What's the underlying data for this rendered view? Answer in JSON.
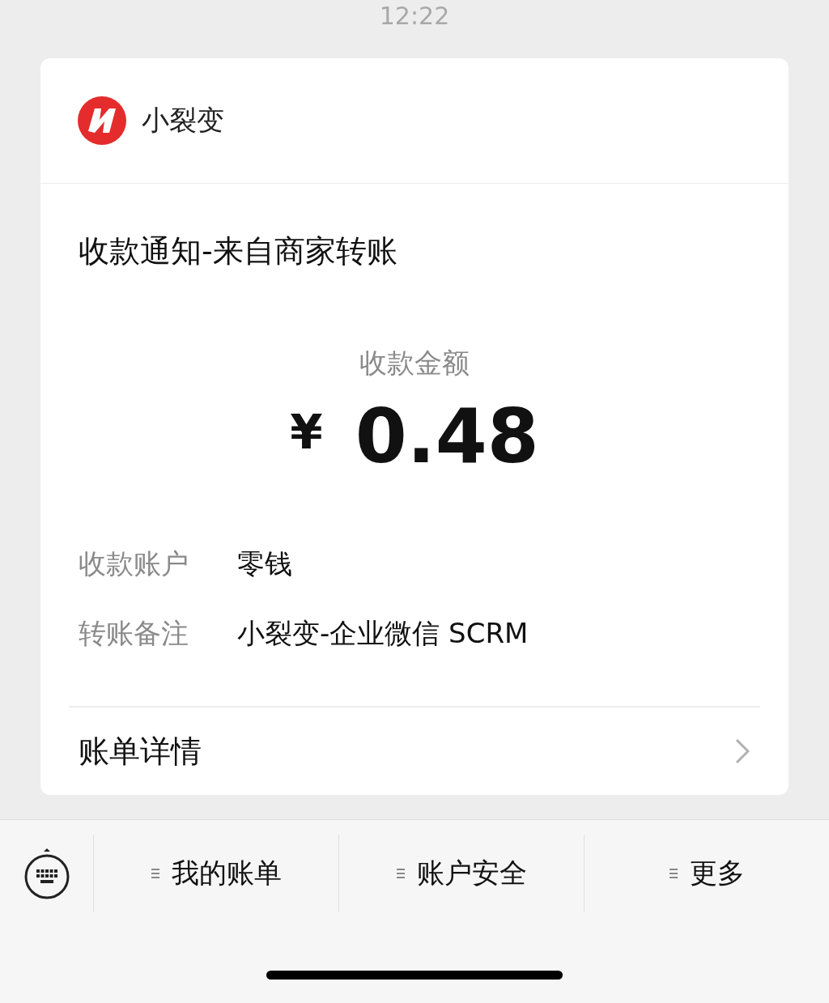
{
  "status_bar": {
    "time": "12:22"
  },
  "card": {
    "brand": "小裂变",
    "title": "收款通知-来自商家转账",
    "amount_label": "收款金额",
    "currency": "¥",
    "amount": "0.48",
    "details": [
      {
        "label": "收款账户",
        "value": "零钱"
      },
      {
        "label": "转账备注",
        "value": "小裂变-企业微信 SCRM"
      }
    ],
    "link": "账单详情"
  },
  "menu": [
    {
      "label": "我的账单"
    },
    {
      "label": "账户安全"
    },
    {
      "label": "更多"
    }
  ]
}
